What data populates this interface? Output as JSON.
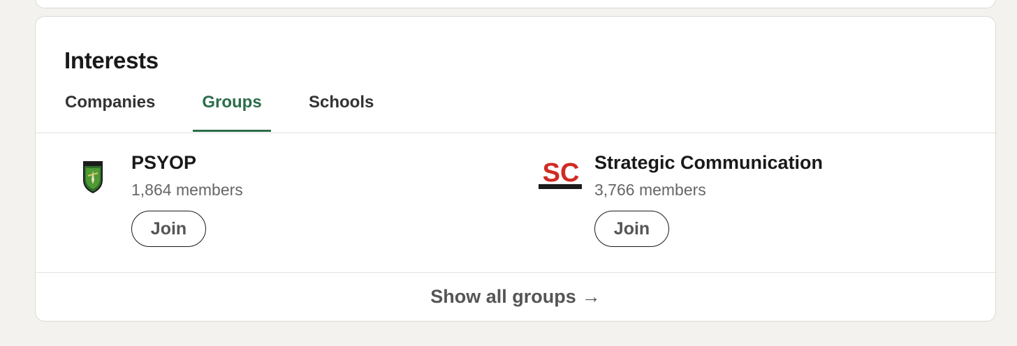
{
  "section": {
    "title": "Interests",
    "tabs": [
      {
        "label": "Companies",
        "selected": false
      },
      {
        "label": "Groups",
        "selected": true
      },
      {
        "label": "Schools",
        "selected": false
      }
    ],
    "accent_color": "#2b6d4a"
  },
  "groups": [
    {
      "name": "PSYOP",
      "members": "1,864 members",
      "join_label": "Join",
      "logo": "shield-logo-icon"
    },
    {
      "name": "Strategic Communication",
      "members": "3,766 members",
      "join_label": "Join",
      "logo": "sc-logo",
      "logo_text": "SC"
    }
  ],
  "footer": {
    "show_all_label": "Show all groups",
    "arrow": "→"
  }
}
